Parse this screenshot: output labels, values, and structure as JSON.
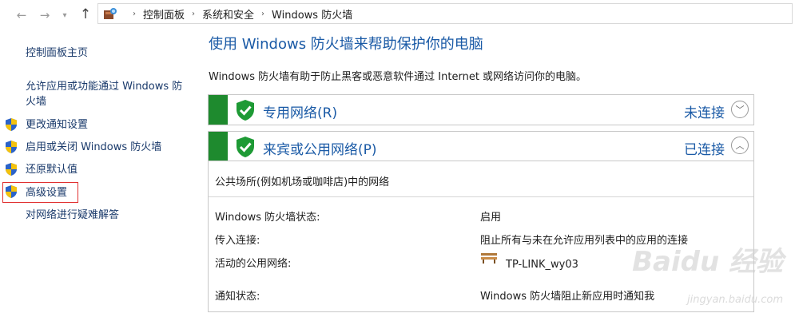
{
  "nav": {
    "back_icon": "arrow-left-icon",
    "forward_icon": "arrow-right-icon",
    "recent_icon": "chevron-down-icon",
    "up_icon": "arrow-up-icon"
  },
  "breadcrumb": {
    "items": [
      "控制面板",
      "系统和安全",
      "Windows 防火墙"
    ],
    "separator": "›"
  },
  "sidebar": {
    "items": [
      {
        "label": "控制面板主页",
        "shield": false
      },
      {
        "label": "允许应用或功能通过 Windows 防火墙",
        "shield": false
      },
      {
        "label": "更改通知设置",
        "shield": true
      },
      {
        "label": "启用或关闭 Windows 防火墙",
        "shield": true
      },
      {
        "label": "还原默认值",
        "shield": true
      },
      {
        "label": "高级设置",
        "shield": true,
        "highlighted": true
      },
      {
        "label": "对网络进行疑难解答",
        "shield": false
      }
    ]
  },
  "main": {
    "title": "使用 Windows 防火墙来帮助保护你的电脑",
    "description": "Windows 防火墙有助于防止黑客或恶意软件通过 Internet 或网络访问你的电脑。",
    "networks": [
      {
        "name": "专用网络(R)",
        "status": "未连接",
        "expanded": false
      },
      {
        "name": "来宾或公用网络(P)",
        "status": "已连接",
        "expanded": true
      }
    ],
    "public_details": {
      "header": "公共场所(例如机场或咖啡店)中的网络",
      "rows": [
        {
          "label": "Windows 防火墙状态:",
          "value": "启用"
        },
        {
          "label": "传入连接:",
          "value": "阻止所有与未在允许应用列表中的应用的连接"
        },
        {
          "label": "活动的公用网络:",
          "value": "TP-LINK_wy03"
        },
        {
          "label": "通知状态:",
          "value": "Windows 防火墙阻止新应用时通知我"
        }
      ]
    }
  },
  "watermark": {
    "text": "Baidu 经验",
    "url": "jingyan.baidu.com"
  },
  "colors": {
    "link": "#1a5aa6",
    "green_bar": "#1e8a2e",
    "highlight_border": "#e03030"
  }
}
